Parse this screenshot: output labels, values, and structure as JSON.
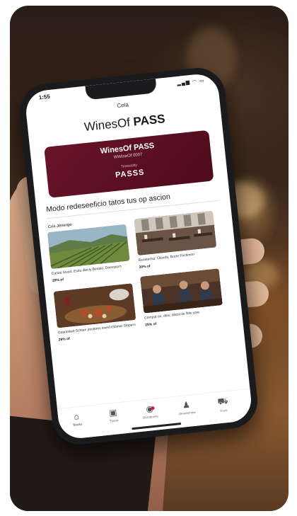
{
  "status": {
    "time": "1:55",
    "icons": "▂▄▆ ◠ ▭"
  },
  "nav": {
    "title": "Cela"
  },
  "brand": {
    "prefix": "WinesOf ",
    "bold": "PASS"
  },
  "pass_card": {
    "title": "WinesOf PASS",
    "subtitle": "WWineOf 0007",
    "small": "Timestotty",
    "label": "PASSS"
  },
  "headline": "Modo redeseeficio tatos tus op ascion",
  "section_title": "Cris Jenergo",
  "cards": [
    {
      "caption": "Caoiat Stvad, Esitu dlecly Beoale, Doestacro",
      "price": "29% of"
    },
    {
      "caption": "Reosterlsu: Olavda, Bucle Foctimon",
      "price": "30% of"
    },
    {
      "caption": "Goanoltwo Schtan jrovtoms ioved tSbmar Stopers",
      "price": "29% of"
    },
    {
      "caption": "Compqt ox, dbis, doost tie fkte sore",
      "price": "25% of"
    }
  ],
  "tabs": [
    {
      "label": "Tooolo",
      "icon": "⌂"
    },
    {
      "label": "Tloem",
      "icon": "▣"
    },
    {
      "label": "Ouruttoove",
      "icon": "◉"
    },
    {
      "label": "Oexresmew",
      "icon": "♟"
    },
    {
      "label": "Foos",
      "icon": "⛟"
    }
  ]
}
